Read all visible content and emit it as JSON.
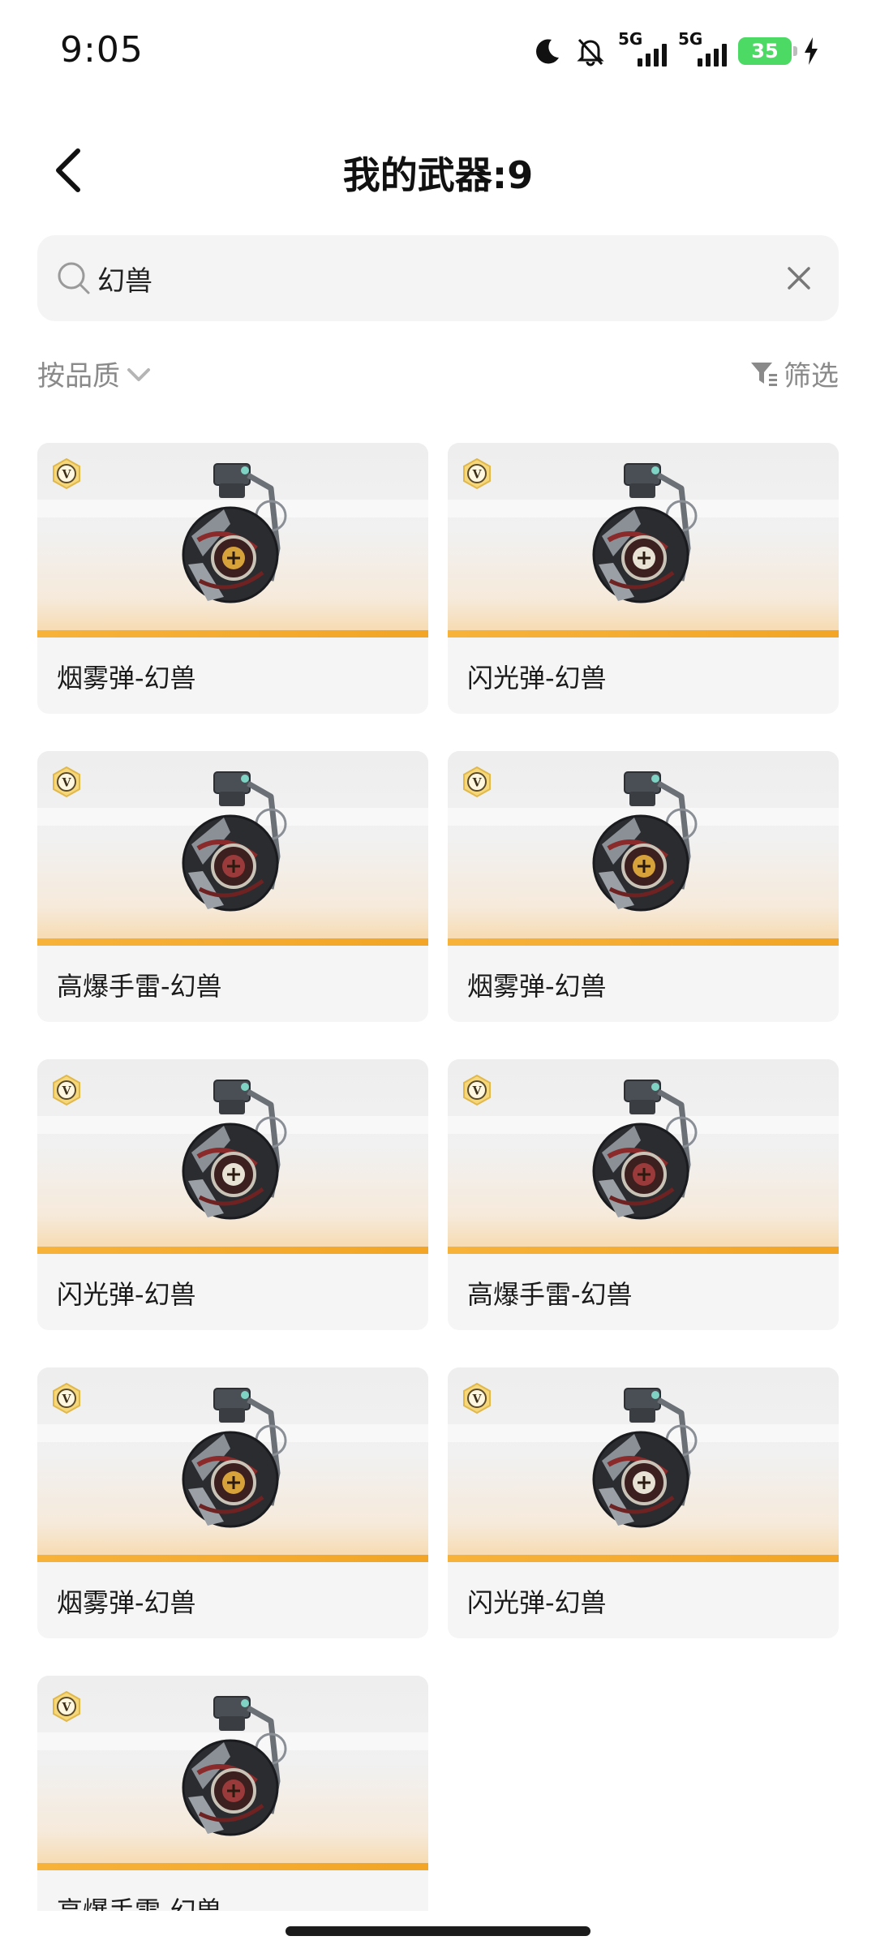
{
  "status_bar": {
    "time": "9:05",
    "network_1": "5G",
    "network_2": "5G",
    "battery": "35",
    "icons": [
      "moon-icon",
      "bell-muted-icon",
      "signal-icon",
      "signal-icon",
      "battery-icon",
      "charging-icon"
    ]
  },
  "header": {
    "title": "我的武器:9"
  },
  "search": {
    "value": "幻兽",
    "placeholder": ""
  },
  "toolbar": {
    "sort_label": "按品质",
    "filter_label": "筛选"
  },
  "colors": {
    "accent_band": "#f2a526",
    "battery": "#4cd964",
    "badge": "#f2c94c"
  },
  "weapons": [
    {
      "name": "烟雾弹-幻兽",
      "core": "gold",
      "rarity_badge": "V"
    },
    {
      "name": "闪光弹-幻兽",
      "core": "white",
      "rarity_badge": "V"
    },
    {
      "name": "高爆手雷-幻兽",
      "core": "red",
      "rarity_badge": "V"
    },
    {
      "name": "烟雾弹-幻兽",
      "core": "gold",
      "rarity_badge": "V"
    },
    {
      "name": "闪光弹-幻兽",
      "core": "white",
      "rarity_badge": "V"
    },
    {
      "name": "高爆手雷-幻兽",
      "core": "red",
      "rarity_badge": "V"
    },
    {
      "name": "烟雾弹-幻兽",
      "core": "gold",
      "rarity_badge": "V"
    },
    {
      "name": "闪光弹-幻兽",
      "core": "white",
      "rarity_badge": "V"
    },
    {
      "name": "高爆手雷-幻兽",
      "core": "red",
      "rarity_badge": "V"
    }
  ]
}
